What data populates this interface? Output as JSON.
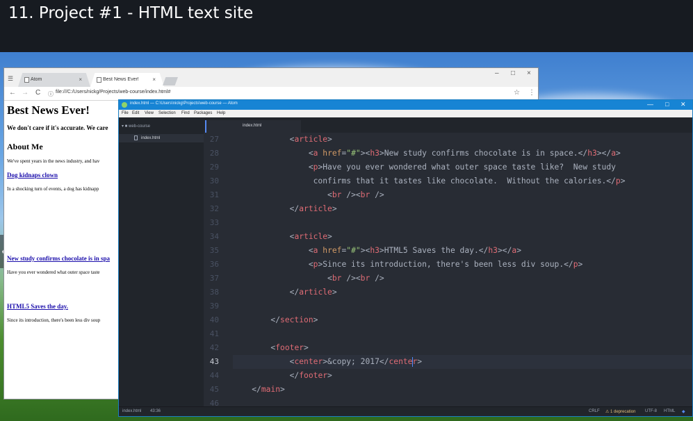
{
  "video": {
    "title": "11. Project #1 - HTML text site"
  },
  "nav": {
    "left": "❮",
    "right": "❯"
  },
  "browser": {
    "tabs": [
      {
        "label": "Atom",
        "close": "×"
      },
      {
        "label": "Best News Ever!",
        "close": "×"
      }
    ],
    "window_controls": {
      "minimize": "–",
      "maximize": "□",
      "close": "×"
    },
    "toolbar": {
      "back": "←",
      "forward": "→",
      "reload": "C",
      "info": "ⓘ",
      "star": "☆",
      "more": "⋮"
    },
    "address": "file:///C:/Users/nickg/Projects/web-course/index.html#",
    "page": {
      "heading": "Best News Ever!",
      "tagline": "We don't care if it's accurate. We care",
      "about_heading": "About Me",
      "about_text": "We've spent years in the news industry, and hav",
      "articles": [
        {
          "link": "Dog kidnaps clown",
          "text": "In a shocking turn of events, a dog has kidnapp"
        },
        {
          "link": "New study confirms chocolate is in spa",
          "text": "Have you ever wondered what outer space taste"
        },
        {
          "link": "HTML5 Saves the day.",
          "text": "Since its introduction, there's been less div soup"
        }
      ]
    }
  },
  "atom": {
    "title": "index.html — C:\\Users\\nickg\\Projects\\web-course — Atom",
    "window_controls": {
      "minimize": "—",
      "maximize": "□",
      "close": "✕"
    },
    "menu": [
      "File",
      "Edit",
      "View",
      "Selection",
      "Find",
      "Packages",
      "Help"
    ],
    "tree": {
      "folder": "web-course",
      "file": "index.html"
    },
    "tab": "index.html",
    "line_numbers": [
      "27",
      "28",
      "29",
      "30",
      "31",
      "32",
      "33",
      "34",
      "35",
      "36",
      "37",
      "38",
      "39",
      "40",
      "41",
      "42",
      "43",
      "44",
      "45",
      "46"
    ],
    "current_line": "43",
    "status": {
      "file": "index.html",
      "position": "43:36",
      "line_ending": "CRLF",
      "warning": "⚠ 1 deprecation",
      "encoding": "UTF-8",
      "grammar": "HTML"
    }
  },
  "colors": {
    "accent": "#1784d4",
    "editor_bg": "#282c34",
    "tag": "#e06c75",
    "attr": "#d19a66",
    "string": "#98c379"
  }
}
